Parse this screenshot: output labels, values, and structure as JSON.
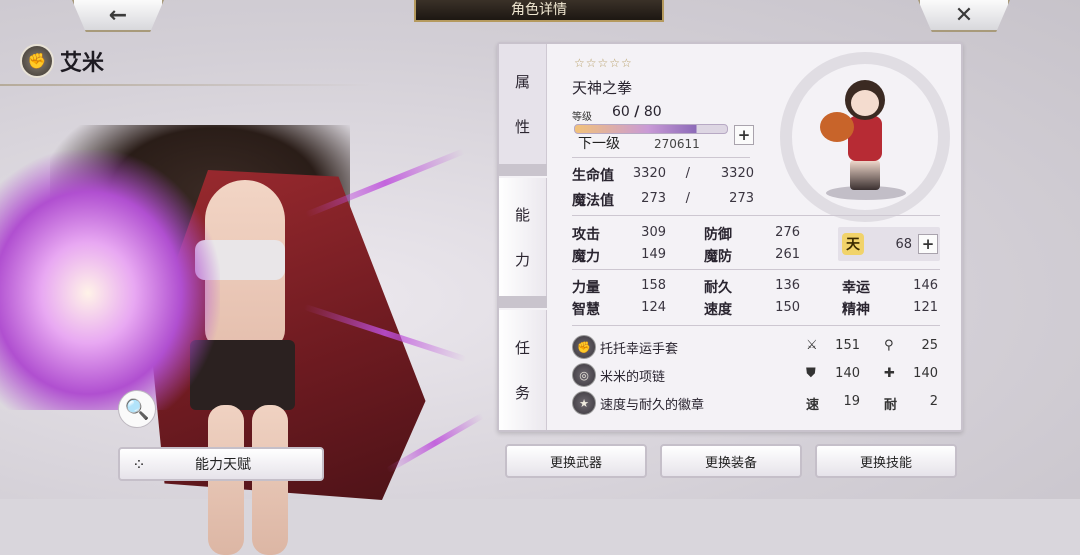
{
  "header": {
    "title": "角色详情",
    "back_icon": "←",
    "close_icon": "✕"
  },
  "character": {
    "name": "艾米",
    "class_icon": "✊",
    "title": "天神之拳",
    "stars": "☆☆☆☆☆",
    "level_label": "等级",
    "level": "60",
    "level_sep": "/",
    "level_max": "80",
    "next_label": "下一级",
    "next_exp": "270611",
    "exp_progress": 0.8
  },
  "tabs": {
    "attr": [
      "属",
      "性"
    ],
    "ability": [
      "能",
      "力"
    ],
    "quest": [
      "任",
      "务"
    ]
  },
  "vitals": {
    "hp_label": "生命值",
    "hp": "3320",
    "hp_sep": "/",
    "hp_max": "3320",
    "mp_label": "魔法值",
    "mp": "273",
    "mp_sep": "/",
    "mp_max": "273"
  },
  "combat": {
    "atk_label": "攻击",
    "atk": "309",
    "def_label": "防御",
    "def": "276",
    "mag_label": "魔力",
    "mag": "149",
    "mdef_label": "魔防",
    "mdef": "261",
    "heaven_icon": "天",
    "heaven": "68"
  },
  "attributes": {
    "str_label": "力量",
    "str": "158",
    "end_label": "耐久",
    "end": "136",
    "luck_label": "幸运",
    "luck": "146",
    "int_label": "智慧",
    "int": "124",
    "spd_label": "速度",
    "spd": "150",
    "spi_label": "精神",
    "spi": "121"
  },
  "equipment": [
    {
      "name": "托托幸运手套",
      "icon": "✊",
      "stat1_icon": "⚔",
      "stat1": "151",
      "stat2_icon": "⚲",
      "stat2": "25"
    },
    {
      "name": "米米的项链",
      "icon": "◎",
      "stat1_icon": "⛊",
      "stat1": "140",
      "stat2_icon": "✚",
      "stat2": "140"
    },
    {
      "name": "速度与耐久的徽章",
      "icon": "★",
      "stat1_icon": "速",
      "stat1": "19",
      "stat2_icon": "耐",
      "stat2": "2"
    }
  ],
  "buttons": {
    "talent_icon": "⁘",
    "talent": "能力天赋",
    "change_weapon": "更换武器",
    "change_gear": "更换装备",
    "change_skill": "更换技能",
    "zoom_icon": "🔍",
    "plus": "+"
  }
}
